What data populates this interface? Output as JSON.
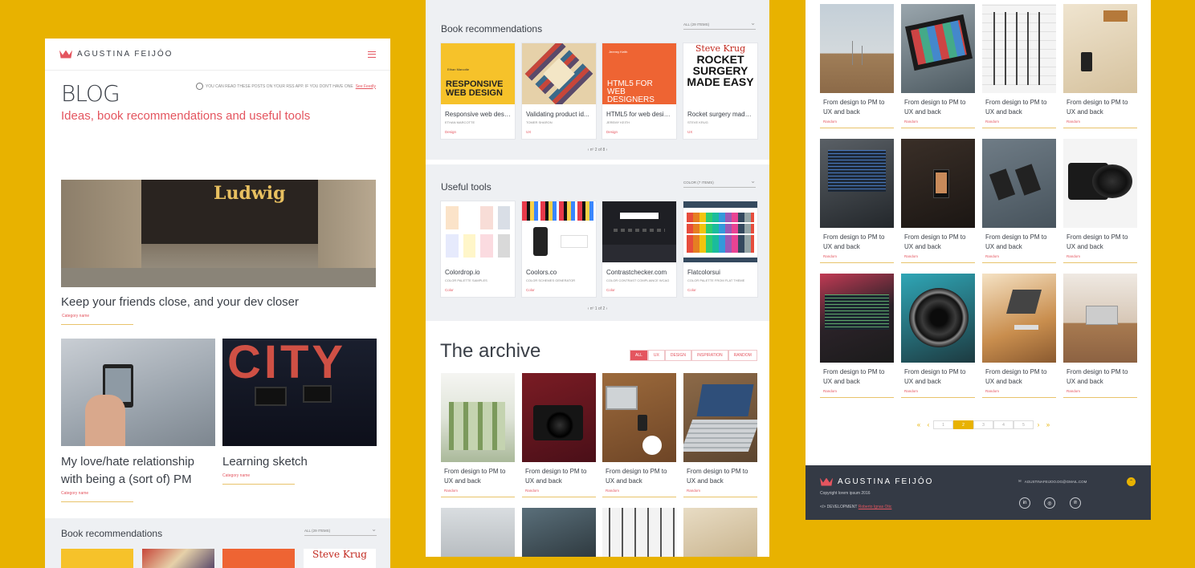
{
  "brand": {
    "name": "AGUSTINA FEIJÓO"
  },
  "blog": {
    "title": "BLOG",
    "subtitle": "Ideas, book recommendations and useful tools",
    "rss_text": "YOU CAN READ THESE POSTS ON YOUR RSS APP. IF YOU DON'T HAVE ONE",
    "rss_link": "See Feedly",
    "posts": [
      {
        "title": "Keep your friends close, and your dev closer",
        "category": "Category name",
        "sign": "Ludwig"
      },
      {
        "title": "My love/hate relationship with being a (sort of) PM",
        "category": "Category name"
      },
      {
        "title": "Learning sketch",
        "category": "Category name",
        "sign": "CITY"
      }
    ]
  },
  "books": {
    "heading": "Book recommendations",
    "dropdown": "ALL (29 ITEMS)",
    "pager": "nº 2 of 8",
    "items": [
      {
        "title": "Responsive web design",
        "author": "ETHAN MARCOTTE",
        "cat": "Design",
        "cover": "RESPONSIVE WEB DESIGN",
        "cover_author": "Ethan Marcotte"
      },
      {
        "title": "Validating product id...",
        "author": "TOMER SHARON",
        "cat": "UX"
      },
      {
        "title": "HTML5 for web desig...",
        "author": "JEREMY KEITH",
        "cat": "Design",
        "cover": "HTML5 FOR WEB DESIGNERS",
        "cover_author": "Jeremy Keith"
      },
      {
        "title": "Rocket surgery made...",
        "author": "STEVE KRUG",
        "cat": "UX",
        "cover": "ROCKET SURGERY MADE EASY",
        "cover_author": "Steve Krug"
      }
    ]
  },
  "tools": {
    "heading": "Useful tools",
    "dropdown": "COLOR (7 ITEMS)",
    "pager": "nº 1 of 2",
    "items": [
      {
        "title": "Colordrop.io",
        "sub": "COLOR PALETTE SAMPLES",
        "cat": "Color"
      },
      {
        "title": "Coolors.co",
        "sub": "COLOR SCHEMES GENERATOR",
        "cat": "Color"
      },
      {
        "title": "Contrastchecker.com",
        "sub": "COLOR CONTRAST COMPLIANCE WCAG",
        "cat": "Color"
      },
      {
        "title": "Flatcolorsui",
        "sub": "COLOR PALETTE FROM FLAT THEME",
        "cat": "Color"
      }
    ]
  },
  "archive": {
    "heading": "The archive",
    "filters": [
      "ALL",
      "UX",
      "DESIGN",
      "INSPIRATION",
      "RANDOM"
    ],
    "item_title": "From design to PM to UX and back",
    "item_cat": "Random"
  },
  "pagination": {
    "pages": [
      "1",
      "2",
      "3",
      "4",
      "5"
    ],
    "current": "2",
    "first": "«",
    "prev": "‹",
    "next": "›",
    "last": "»"
  },
  "footer": {
    "copyright": "Copyright lorem ipsum 2016",
    "dev_label": "DEVELOPMENT",
    "dev_name": "Roberto Ignas Otic",
    "email": "AGUSTINAFEIJOO.DG@GMAIL.COM",
    "social": [
      "in",
      "◎",
      "℗"
    ],
    "up": "⌃"
  },
  "colors": {
    "accent": "#e4555f",
    "yellow": "#e8b200",
    "dark": "#343a45"
  }
}
